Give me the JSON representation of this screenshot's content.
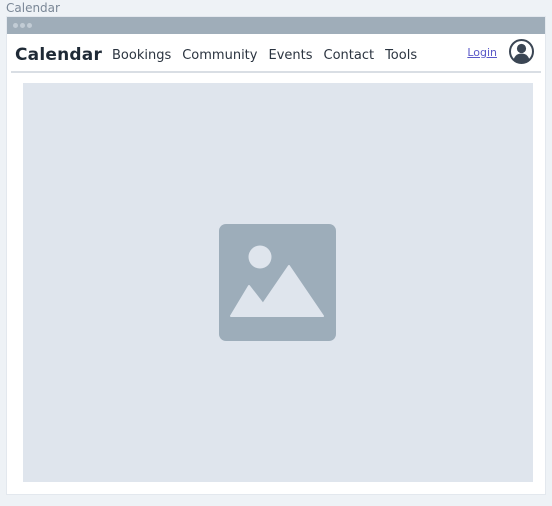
{
  "page": {
    "caption": "Calendar"
  },
  "navbar": {
    "brand": "Calendar",
    "links": [
      {
        "label": "Bookings"
      },
      {
        "label": "Community"
      },
      {
        "label": "Events"
      },
      {
        "label": "Contact"
      },
      {
        "label": "Tools"
      }
    ],
    "login_label": "Login",
    "avatar_icon": "user-avatar-icon"
  },
  "hero": {
    "icon": "image-placeholder-icon"
  },
  "colors": {
    "background": "#eef2f6",
    "titlebar": "#9fadb9",
    "hero": "#dfe5ed",
    "placeholder": "#9dadba",
    "login_link": "#5a58c8",
    "text": "#1f2a36"
  }
}
